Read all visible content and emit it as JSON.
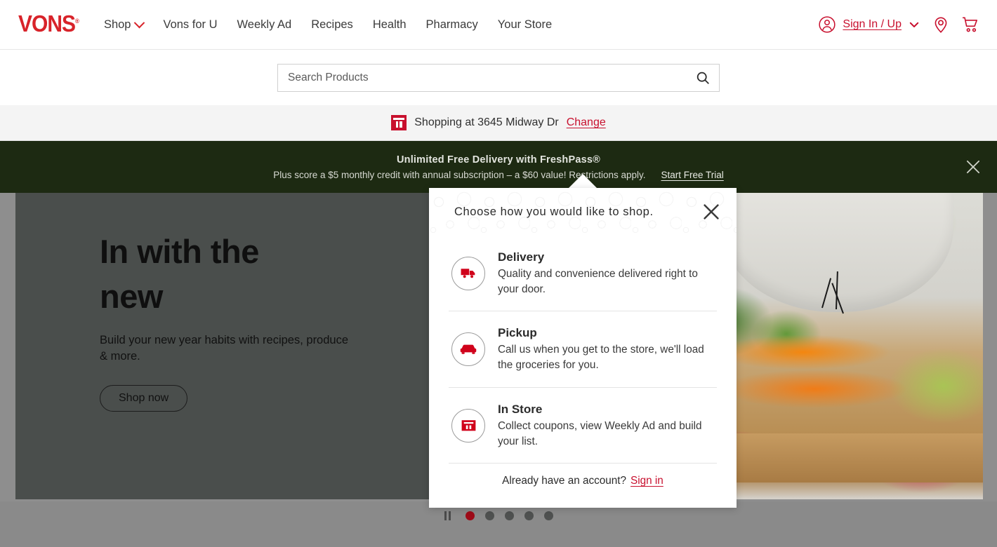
{
  "brand": {
    "logo_text": "VONS",
    "accent_red": "#c8102e",
    "banner_green": "#1d2a12"
  },
  "nav": {
    "items": [
      {
        "label": "Shop",
        "has_caret": true
      },
      {
        "label": "Vons for U",
        "has_caret": false
      },
      {
        "label": "Weekly Ad",
        "has_caret": false
      },
      {
        "label": "Recipes",
        "has_caret": false
      },
      {
        "label": "Health",
        "has_caret": false
      },
      {
        "label": "Pharmacy",
        "has_caret": false
      },
      {
        "label": "Your Store",
        "has_caret": false
      }
    ],
    "sign_in_label": "Sign In / Up",
    "icons": [
      "account-circle-icon",
      "chevron-down-icon",
      "location-pin-icon",
      "shopping-cart-icon"
    ]
  },
  "search": {
    "placeholder": "Search Products",
    "value": "",
    "icon": "search-icon"
  },
  "store_bar": {
    "icon": "store-icon",
    "text": "Shopping at 3645 Midway Dr",
    "change_label": "Change"
  },
  "promo_banner": {
    "title": "Unlimited Free Delivery with FreshPass®",
    "subtitle": "Plus score a $5 monthly credit with annual subscription – a $60 value! Restrictions apply.",
    "cta_label": "Start Free Trial",
    "close_icon": "close-icon"
  },
  "hero": {
    "heading": "In with the new",
    "paragraph": "Build your new year habits with recipes, produce & more.",
    "button_label": "Shop now",
    "carousel": {
      "pause_label": "Pause",
      "dot_count": 5,
      "active_dot": 1
    }
  },
  "modal": {
    "title": "Choose how you would like to shop.",
    "close_icon": "close-icon",
    "options": [
      {
        "icon": "delivery-truck-icon",
        "title": "Delivery",
        "description": "Quality and convenience delivered right to your door."
      },
      {
        "icon": "pickup-car-icon",
        "title": "Pickup",
        "description": "Call us when you get to the store, we'll load the groceries for you."
      },
      {
        "icon": "store-icon",
        "title": "In Store",
        "description": "Collect coupons, view Weekly Ad and build your list."
      }
    ],
    "footer_text": "Already have an account?",
    "footer_link": "Sign in"
  }
}
